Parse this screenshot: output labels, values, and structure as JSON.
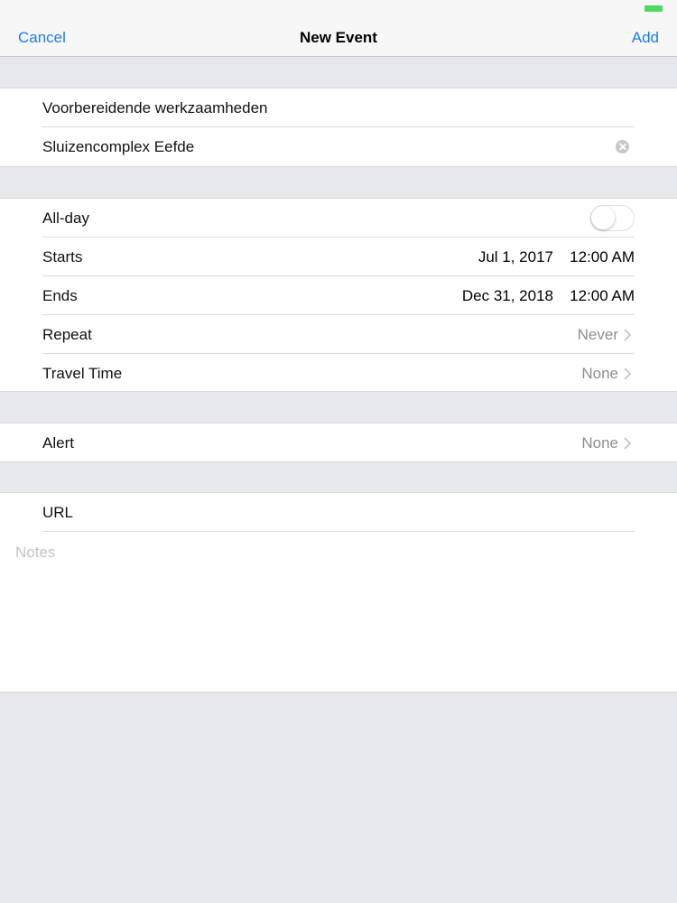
{
  "nav": {
    "cancel": "Cancel",
    "title": "New Event",
    "add": "Add"
  },
  "event": {
    "title": "Voorbereidende werkzaamheden",
    "location": "Sluizencomplex Eefde"
  },
  "time": {
    "allday_label": "All-day",
    "allday_on": false,
    "starts_label": "Starts",
    "starts_date": "Jul 1, 2017",
    "starts_time": "12:00 AM",
    "ends_label": "Ends",
    "ends_date": "Dec 31, 2018",
    "ends_time": "12:00 AM",
    "repeat_label": "Repeat",
    "repeat_value": "Never",
    "travel_label": "Travel Time",
    "travel_value": "None"
  },
  "alert": {
    "label": "Alert",
    "value": "None"
  },
  "extra": {
    "url_placeholder": "URL",
    "notes_placeholder": "Notes"
  },
  "colors": {
    "tint": "#1a7cf4",
    "battery": "#4cd964"
  }
}
